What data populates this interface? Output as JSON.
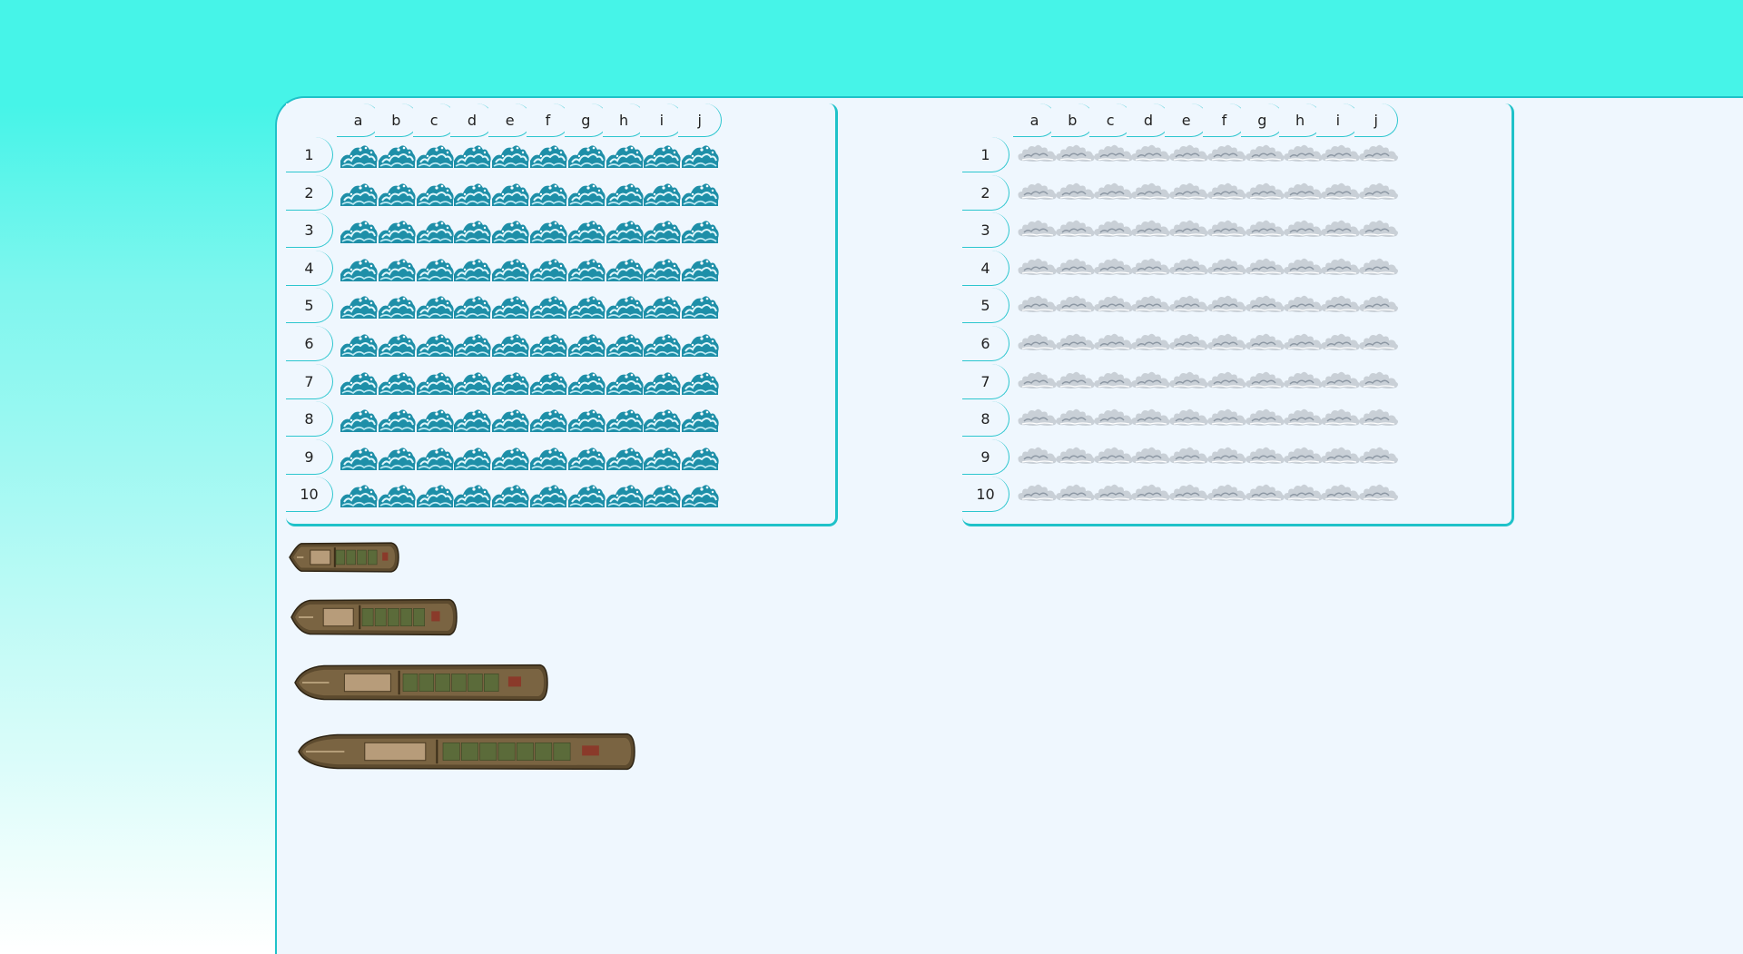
{
  "player_board": {
    "columns": [
      "a",
      "b",
      "c",
      "d",
      "e",
      "f",
      "g",
      "h",
      "i",
      "j"
    ],
    "rows": [
      "1",
      "2",
      "3",
      "4",
      "5",
      "6",
      "7",
      "8",
      "9",
      "10"
    ],
    "cell_icon": "wave-icon"
  },
  "enemy_board": {
    "columns": [
      "a",
      "b",
      "c",
      "d",
      "e",
      "f",
      "g",
      "h",
      "i",
      "j"
    ],
    "rows": [
      "1",
      "2",
      "3",
      "4",
      "5",
      "6",
      "7",
      "8",
      "9",
      "10"
    ],
    "cell_icon": "cloud-icon"
  },
  "ships": [
    {
      "name": "ship-2",
      "length": 2
    },
    {
      "name": "ship-3",
      "length": 3
    },
    {
      "name": "ship-4",
      "length": 4
    },
    {
      "name": "ship-5",
      "length": 5
    }
  ],
  "colors": {
    "border": "#1fc2c9",
    "background_top": "#46f4e8",
    "panel": "#eff7fe",
    "wave": "#1e8fa8",
    "cloud": "#b9c2cc",
    "ship_hull": "#5c4a2e"
  }
}
